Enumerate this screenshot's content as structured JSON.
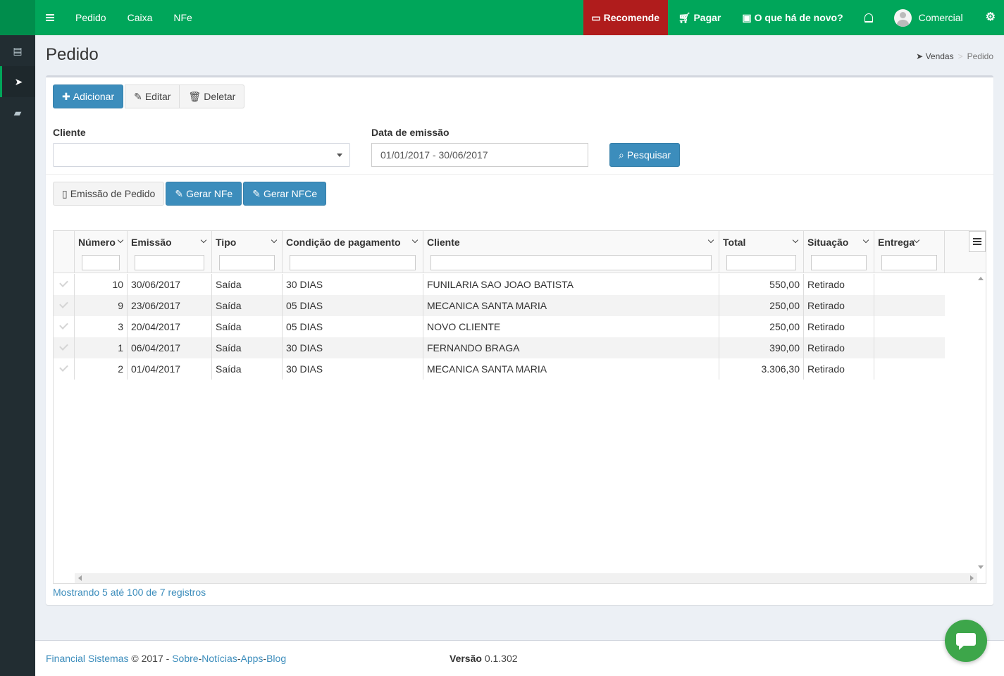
{
  "topnav": {
    "menu": [
      "Pedido",
      "Caixa",
      "NFe"
    ],
    "recomende": "Recomende",
    "pagar": "Pagar",
    "novidades": "O que há de novo?",
    "user": "Comercial"
  },
  "page": {
    "title": "Pedido",
    "breadcrumb": {
      "parent": "Vendas",
      "sep": ">",
      "current": "Pedido"
    }
  },
  "toolbar": {
    "add": "Adicionar",
    "edit": "Editar",
    "delete": "Deletar"
  },
  "filters": {
    "cliente_label": "Cliente",
    "cliente_value": "",
    "data_label": "Data de emissão",
    "data_value": "01/01/2017 - 30/06/2017",
    "search": "Pesquisar"
  },
  "actions": {
    "emissao": "Emissão de Pedido",
    "gerar_nfe": "Gerar NFe",
    "gerar_nfce": "Gerar NFCe"
  },
  "grid": {
    "columns": [
      "Número",
      "Emissão",
      "Tipo",
      "Condição de pagamento",
      "Cliente",
      "Total",
      "Situação",
      "Entrega"
    ],
    "rows": [
      {
        "numero": "10",
        "emissao": "30/06/2017",
        "tipo": "Saída",
        "condicao": "30 DIAS",
        "cliente": "FUNILARIA SAO JOAO BATISTA",
        "total": "550,00",
        "situacao": "Retirado",
        "entrega": ""
      },
      {
        "numero": "9",
        "emissao": "23/06/2017",
        "tipo": "Saída",
        "condicao": "05 DIAS",
        "cliente": "MECANICA SANTA MARIA",
        "total": "250,00",
        "situacao": "Retirado",
        "entrega": ""
      },
      {
        "numero": "3",
        "emissao": "20/04/2017",
        "tipo": "Saída",
        "condicao": "05 DIAS",
        "cliente": "NOVO CLIENTE",
        "total": "250,00",
        "situacao": "Retirado",
        "entrega": ""
      },
      {
        "numero": "1",
        "emissao": "06/04/2017",
        "tipo": "Saída",
        "condicao": "30 DIAS",
        "cliente": "FERNANDO BRAGA",
        "total": "390,00",
        "situacao": "Retirado",
        "entrega": ""
      },
      {
        "numero": "2",
        "emissao": "01/04/2017",
        "tipo": "Saída",
        "condicao": "30 DIAS",
        "cliente": "MECANICA SANTA MARIA",
        "total": "3.306,30",
        "situacao": "Retirado",
        "entrega": ""
      }
    ],
    "info": "Mostrando 5 até 100 de 7 registros"
  },
  "footer": {
    "company": "Financial Sistemas",
    "copyright": "© 2017",
    "sep": "-",
    "sobre": "Sobre",
    "noticias": "Notícias",
    "apps": "Apps",
    "blog": "Blog",
    "version_label": "Versão",
    "version": "0.1.302"
  }
}
